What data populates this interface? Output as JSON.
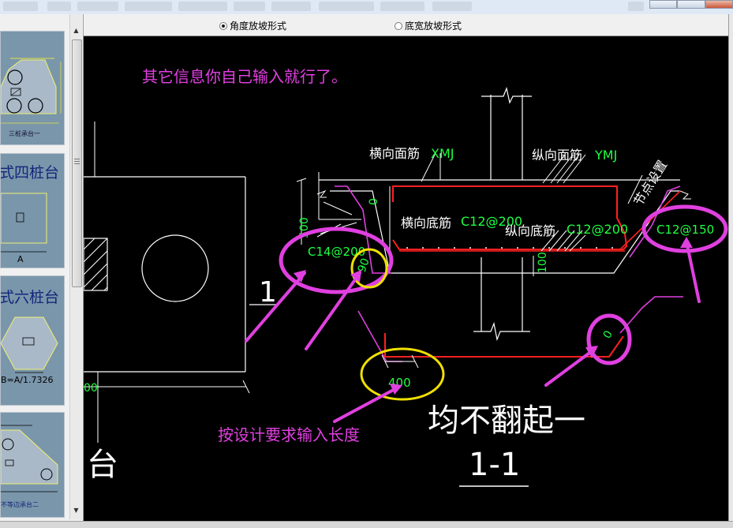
{
  "radio_options": [
    {
      "label": "角度放坡形式",
      "selected": true
    },
    {
      "label": "底宽放坡形式",
      "selected": false
    }
  ],
  "thumbnails": [
    {
      "caption": "三桩承台一"
    },
    {
      "caption": "式四桩台",
      "dim": "A"
    },
    {
      "caption": "式六桩台",
      "formula": "B=A/1.7326"
    },
    {
      "caption": "不等边承台二"
    }
  ],
  "drawing": {
    "note_info": "其它信息你自己输入就行了。",
    "note_length": "按设计要求输入长度",
    "note_bottom": "均不翻起一",
    "section": "1-1",
    "section_mark": "1",
    "left_char": "台",
    "left_dim": "00",
    "label_top_h": "横向面筋",
    "label_top_h_code": "XMJ",
    "label_top_v": "纵向面筋",
    "label_top_v_code": "YMJ",
    "label_bot_h": "横向底筋",
    "label_bot_h_code": "C12@200",
    "label_bot_v": "纵向底筋",
    "label_bot_v_code": "C12@200",
    "node_setting": "节点设置",
    "left_bar": "C14@200",
    "right_bar": "C12@150",
    "angle": "90",
    "dim_400": "400",
    "dim_100": "100",
    "dim_500": "500",
    "zero_a": "0",
    "zero_b": "0"
  },
  "colors": {
    "canvas_bg": "#000000",
    "annotation_magenta": "#e040e0",
    "highlight_yellow": "#f0e000",
    "rebar_red": "#ff2020",
    "code_green": "#20ff40",
    "line_white": "#ffffff"
  }
}
